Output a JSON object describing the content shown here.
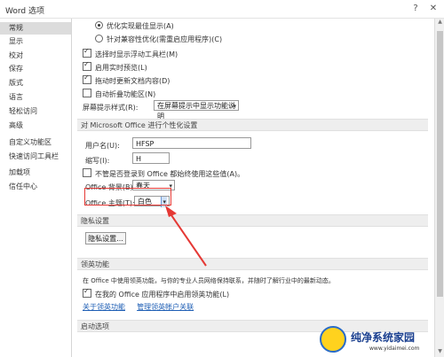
{
  "window": {
    "title": "Word 选项",
    "help": "?",
    "close": "✕"
  },
  "sidebar": {
    "items": [
      {
        "label": "常规",
        "active": true
      },
      {
        "label": "显示"
      },
      {
        "label": "校对"
      },
      {
        "label": "保存"
      },
      {
        "label": "版式"
      },
      {
        "label": "语言"
      },
      {
        "label": "轻松访问"
      },
      {
        "label": "高级"
      },
      {
        "label": "自定义功能区"
      },
      {
        "label": "快速访问工具栏"
      },
      {
        "label": "加载项"
      },
      {
        "label": "信任中心"
      }
    ]
  },
  "ui": {
    "opt_best_display": "优化实现最佳显示(A)",
    "opt_compat": "针对兼容性优化(需重启应用程序)(C)",
    "cb_mini_toolbar": "选择时显示浮动工具栏(M)",
    "cb_live_preview": "启用实时预览(L)",
    "cb_drag_update": "拖动时更新文档内容(D)",
    "cb_collapse_ribbon": "自动折叠功能区(N)",
    "screentip_label": "屏幕提示样式(R):",
    "screentip_value": "在屏幕提示中显示功能说明"
  },
  "personalize": {
    "header": "对 Microsoft Office 进行个性化设置",
    "username_label": "用户名(U):",
    "username_value": "HFSP",
    "initials_label": "缩写(I):",
    "initials_value": "H",
    "always_use_label": "不管是否登录到 Office 都始终使用这些值(A)。",
    "background_label": "Office 背景(B):",
    "background_value": "春天",
    "theme_label": "Office 主题(T):",
    "theme_value": "白色"
  },
  "privacy": {
    "header": "隐私设置",
    "button": "隐私设置..."
  },
  "linkedin": {
    "header": "领英功能",
    "desc": "在 Office 中使用领英功能，与你的专业人员网络保持联系，并随时了解行业中的最新动态。",
    "cb_label": "在我的 Office 应用程序中启用领英功能(L)",
    "link_about": "关于领英功能",
    "link_manage": "管理领英帐户关联"
  },
  "startup": {
    "header": "启动选项"
  },
  "watermark": {
    "title": "纯净系统家园",
    "url": "www.yidaimei.com"
  },
  "colors": {
    "accent_red": "#e53935",
    "link": "#1f5fb5"
  }
}
